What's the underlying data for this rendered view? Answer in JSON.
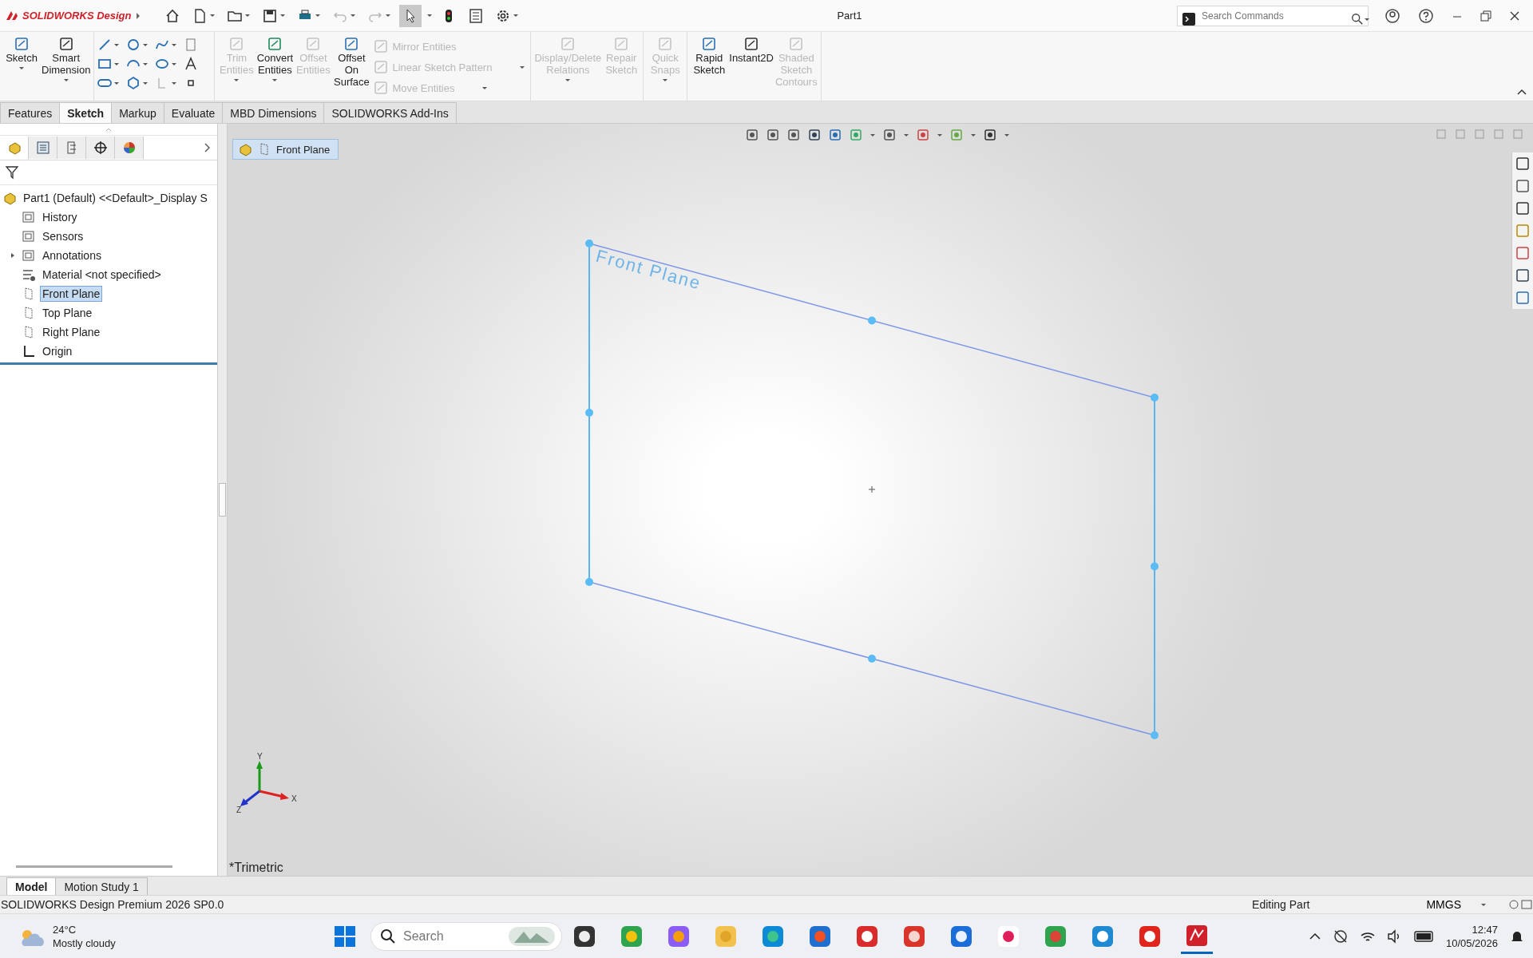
{
  "title_bar": {
    "app_name": "SOLIDWORKS Design",
    "document": "Part1",
    "search": {
      "placeholder": "Search Commands"
    }
  },
  "ribbon": [
    {
      "tools": [
        {
          "label": "Sketch",
          "kind": "large",
          "disabled": false,
          "dropdown": true
        },
        {
          "label": "Smart Dimension",
          "kind": "large",
          "disabled": false,
          "dropdown": true
        }
      ]
    },
    {
      "tools": [
        {
          "kind": "sketch-grid"
        }
      ]
    },
    {
      "tools": [
        {
          "label": "Trim Entities",
          "kind": "large",
          "disabled": true,
          "dropdown": true
        },
        {
          "label": "Convert Entities",
          "kind": "large",
          "disabled": false,
          "dropdown": true
        },
        {
          "label": "Offset Entities",
          "kind": "large",
          "disabled": true,
          "dropdown": false
        },
        {
          "label": "Offset On Surface",
          "kind": "large",
          "disabled": false,
          "dropdown": false
        },
        {
          "label": "Mirror Entities",
          "kind": "small",
          "disabled": true,
          "dropdown": false
        },
        {
          "label": "Linear Sketch Pattern",
          "kind": "small",
          "disabled": true,
          "dropdown": true
        },
        {
          "label": "Move Entities",
          "kind": "small",
          "disabled": true,
          "dropdown": true
        }
      ]
    },
    {
      "tools": [
        {
          "label": "Display/Delete Relations",
          "kind": "large",
          "disabled": true,
          "dropdown": true
        },
        {
          "label": "Repair Sketch",
          "kind": "large",
          "disabled": true,
          "dropdown": false
        }
      ]
    },
    {
      "tools": [
        {
          "label": "Quick Snaps",
          "kind": "large",
          "disabled": true,
          "dropdown": true
        }
      ]
    },
    {
      "tools": [
        {
          "label": "Rapid Sketch",
          "kind": "large",
          "disabled": false,
          "dropdown": false
        },
        {
          "label": "Instant2D",
          "kind": "large",
          "disabled": false,
          "dropdown": false
        },
        {
          "label": "Shaded Sketch Contours",
          "kind": "large",
          "disabled": true,
          "dropdown": false
        }
      ]
    }
  ],
  "tabs": [
    {
      "label": "Features",
      "selected": false
    },
    {
      "label": "Sketch",
      "selected": true
    },
    {
      "label": "Markup",
      "selected": false
    },
    {
      "label": "Evaluate",
      "selected": false
    },
    {
      "label": "MBD Dimensions",
      "selected": false
    },
    {
      "label": "SOLIDWORKS Add-Ins",
      "selected": false
    }
  ],
  "tree": {
    "root": "Part1 (Default) <<Default>_Display S",
    "children": [
      {
        "label": "History",
        "kind": "folder",
        "selected": false,
        "expandable": false
      },
      {
        "label": "Sensors",
        "kind": "folder",
        "selected": false,
        "expandable": false
      },
      {
        "label": "Annotations",
        "kind": "folder",
        "selected": false,
        "expandable": true
      },
      {
        "label": "Material <not specified>",
        "kind": "material",
        "selected": false,
        "expandable": false
      },
      {
        "label": "Front Plane",
        "kind": "plane",
        "selected": true,
        "expandable": false
      },
      {
        "label": "Top Plane",
        "kind": "plane",
        "selected": false,
        "expandable": false
      },
      {
        "label": "Right Plane",
        "kind": "plane",
        "selected": false,
        "expandable": false
      },
      {
        "label": "Origin",
        "kind": "origin",
        "selected": false,
        "expandable": false
      }
    ]
  },
  "viewport": {
    "breadcrumb": "Front Plane",
    "plane_label": "Front Plane",
    "view_name": "*Trimetric",
    "triad": {
      "x": "X",
      "y": "Y",
      "z": "Z"
    }
  },
  "bottom_tabs": [
    {
      "label": "Model",
      "selected": true
    },
    {
      "label": "Motion Study 1",
      "selected": false
    }
  ],
  "status_bar": {
    "product": "SOLIDWORKS Design Premium 2026 SP0.0",
    "mode": "Editing Part",
    "units": "MMGS"
  },
  "taskbar": {
    "weather": {
      "temperature": "24°C",
      "condition": "Mostly cloudy"
    },
    "search": {
      "placeholder": "Search"
    },
    "time": "12:47",
    "date": "10/05/2026"
  }
}
